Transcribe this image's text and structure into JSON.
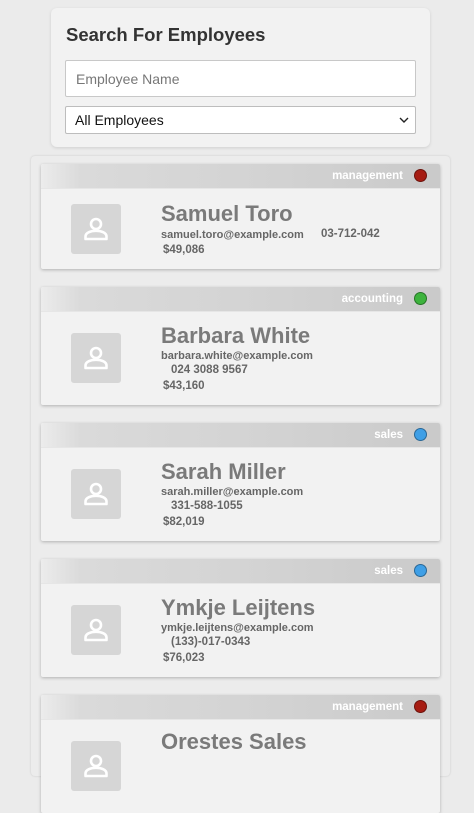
{
  "search": {
    "title": "Search For Employees",
    "name_placeholder": "Employee Name",
    "name_value": "",
    "filter_selected": "All Employees"
  },
  "department_colors": {
    "management": "#a61c12",
    "accounting": "#3db33d",
    "sales": "#3f9fe6"
  },
  "employees": [
    {
      "name": "Samuel Toro",
      "email": "samuel.toro@example.com",
      "phone": "03-712-042",
      "salary": "$49,086",
      "department": "management",
      "dept_color": "#a61c12"
    },
    {
      "name": "Barbara White",
      "email": "barbara.white@example.com",
      "phone": "024 3088 9567",
      "salary": "$43,160",
      "department": "accounting",
      "dept_color": "#3db33d"
    },
    {
      "name": "Sarah Miller",
      "email": "sarah.miller@example.com",
      "phone": "331-588-1055",
      "salary": "$82,019",
      "department": "sales",
      "dept_color": "#3f9fe6"
    },
    {
      "name": "Ymkje Leijtens",
      "email": "ymkje.leijtens@example.com",
      "phone": "(133)-017-0343",
      "salary": "$76,023",
      "department": "sales",
      "dept_color": "#3f9fe6"
    },
    {
      "name": "Orestes Sales",
      "email": "",
      "phone": "",
      "salary": "",
      "department": "management",
      "dept_color": "#a61c12"
    }
  ],
  "icons": {
    "avatar": "person-placeholder-icon",
    "select": "chevron-down-icon",
    "department": "status-dot-icon"
  }
}
